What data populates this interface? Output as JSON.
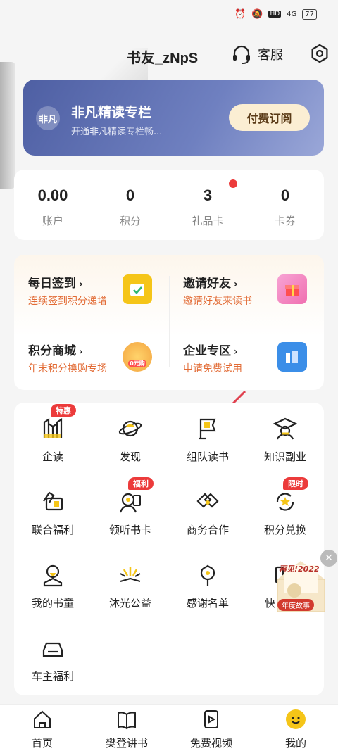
{
  "status_bar": {
    "network": "4G",
    "hd": "HD",
    "battery": "77"
  },
  "header": {
    "username": "书友_zNpS",
    "customer_service": "客服"
  },
  "banner": {
    "logo": "非凡",
    "title": "非凡精读专栏",
    "subtitle": "开通非凡精读专栏畅...",
    "button": "付费订阅"
  },
  "stats": [
    {
      "value": "0.00",
      "label": "账户"
    },
    {
      "value": "0",
      "label": "积分"
    },
    {
      "value": "3",
      "label": "礼品卡"
    },
    {
      "value": "0",
      "label": "卡券"
    }
  ],
  "features": [
    {
      "title": "每日签到",
      "subtitle": "连续签到积分递增",
      "icon": "checkin-icon",
      "color": "#f5c518"
    },
    {
      "title": "邀请好友",
      "subtitle": "邀请好友来读书",
      "icon": "gift-icon",
      "color": "#f06fb0"
    },
    {
      "title": "积分商城",
      "subtitle": "年末积分换购专场",
      "icon": "coin-icon",
      "color": "#f3a440",
      "badge": "0元购"
    },
    {
      "title": "企业专区",
      "subtitle": "申请免费试用",
      "icon": "building-icon",
      "color": "#3b8ee8"
    }
  ],
  "grid": [
    {
      "label": "企读",
      "icon": "enterprise-read-icon",
      "tag": "特惠"
    },
    {
      "label": "发现",
      "icon": "planet-icon"
    },
    {
      "label": "组队读书",
      "icon": "flag-icon"
    },
    {
      "label": "知识副业",
      "icon": "graduate-icon"
    },
    {
      "label": "联合福利",
      "icon": "coupon-icon"
    },
    {
      "label": "领听书卡",
      "icon": "listen-card-icon",
      "tag": "福利"
    },
    {
      "label": "商务合作",
      "icon": "handshake-icon"
    },
    {
      "label": "积分兑换",
      "icon": "exchange-icon",
      "tag": "限时"
    },
    {
      "label": "我的书童",
      "icon": "book-kid-icon"
    },
    {
      "label": "沐光公益",
      "icon": "sunlight-icon"
    },
    {
      "label": "感谢名单",
      "icon": "flower-icon"
    },
    {
      "label": "快",
      "icon": "quick-icon"
    },
    {
      "label": "车主福利",
      "icon": "car-icon"
    }
  ],
  "promo": {
    "text_top": "再见!2022",
    "text_bottom": "年度故事"
  },
  "tabbar": [
    {
      "label": "首页",
      "icon": "home-icon"
    },
    {
      "label": "樊登讲书",
      "icon": "book-icon"
    },
    {
      "label": "免费视频",
      "icon": "video-icon"
    },
    {
      "label": "我的",
      "icon": "smile-avatar-icon"
    }
  ]
}
